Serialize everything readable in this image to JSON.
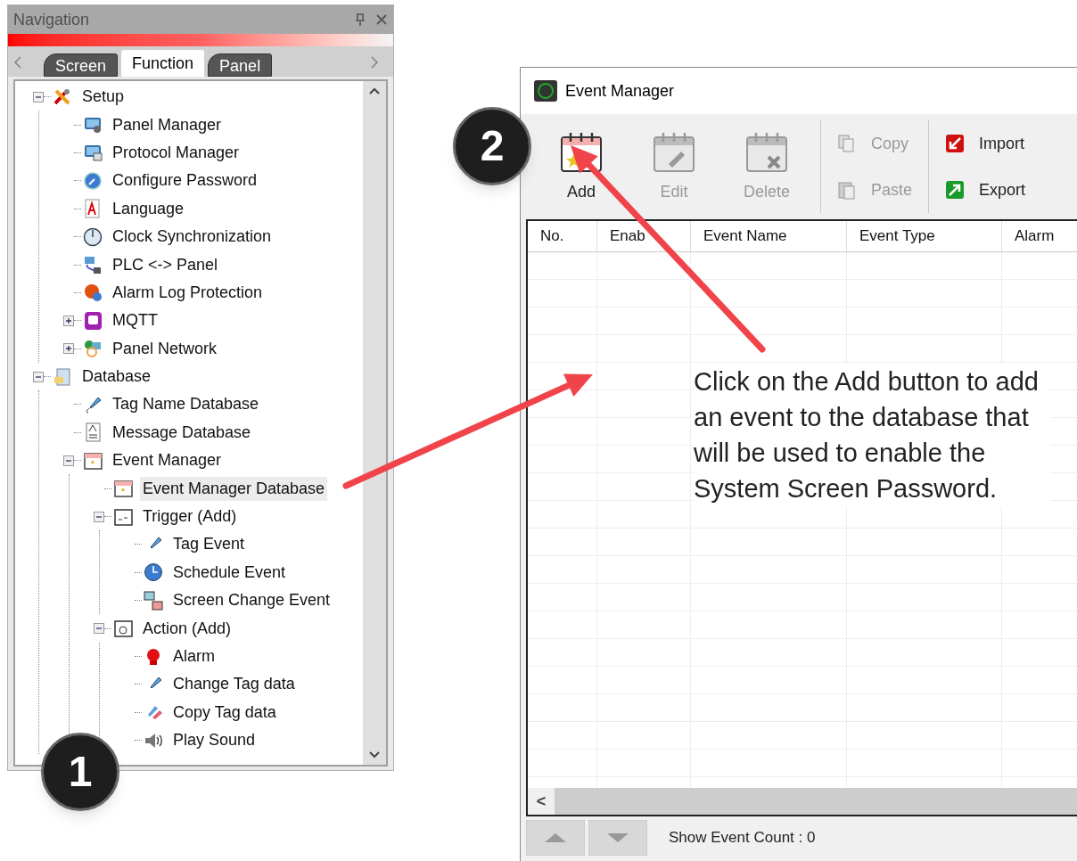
{
  "navigation": {
    "title": "Navigation",
    "tabs": [
      {
        "label": "Screen",
        "selected": false
      },
      {
        "label": "Function",
        "selected": true
      },
      {
        "label": "Panel",
        "selected": false
      }
    ],
    "tree": [
      {
        "label": "Setup",
        "expanded": true,
        "selected": false,
        "children": [
          {
            "label": "Panel Manager",
            "selected": false
          },
          {
            "label": "Protocol Manager",
            "selected": false
          },
          {
            "label": "Configure Password",
            "selected": false
          },
          {
            "label": "Language",
            "selected": false
          },
          {
            "label": "Clock Synchronization",
            "selected": false
          },
          {
            "label": "PLC <-> Panel",
            "selected": false
          },
          {
            "label": "Alarm Log Protection",
            "selected": false
          },
          {
            "label": "MQTT",
            "expanded": false,
            "selected": false
          },
          {
            "label": "Panel Network",
            "expanded": false,
            "selected": false
          }
        ]
      },
      {
        "label": "Database",
        "expanded": true,
        "selected": false,
        "children": [
          {
            "label": "Tag Name Database",
            "selected": false
          },
          {
            "label": "Message Database",
            "selected": false
          },
          {
            "label": "Event Manager",
            "expanded": true,
            "selected": false,
            "children": [
              {
                "label": "Event Manager Database",
                "selected": true
              },
              {
                "label": "Trigger (Add)",
                "expanded": true,
                "selected": false,
                "children": [
                  {
                    "label": "Tag Event",
                    "selected": false
                  },
                  {
                    "label": "Schedule Event",
                    "selected": false
                  },
                  {
                    "label": "Screen Change Event",
                    "selected": false
                  }
                ]
              },
              {
                "label": "Action (Add)",
                "expanded": true,
                "selected": false,
                "children": [
                  {
                    "label": "Alarm",
                    "selected": false
                  },
                  {
                    "label": "Change Tag data",
                    "selected": false
                  },
                  {
                    "label": "Copy Tag data",
                    "selected": false
                  },
                  {
                    "label": "Play Sound",
                    "selected": false
                  }
                ]
              }
            ]
          }
        ]
      }
    ]
  },
  "event_manager": {
    "title": "Event Manager",
    "toolbar": [
      {
        "label": "Add",
        "disabled": false,
        "kind": "large"
      },
      {
        "label": "Edit",
        "disabled": true,
        "kind": "large"
      },
      {
        "label": "Delete",
        "disabled": true,
        "kind": "large"
      },
      {
        "label": "Copy",
        "disabled": true,
        "kind": "small"
      },
      {
        "label": "Paste",
        "disabled": true,
        "kind": "small"
      },
      {
        "label": "Import",
        "disabled": false,
        "kind": "small"
      },
      {
        "label": "Export",
        "disabled": false,
        "kind": "small"
      }
    ],
    "columns": [
      "No.",
      "Enab",
      "Event Name",
      "Event Type",
      "Alarm"
    ],
    "scroll_left": "<",
    "status": "Show Event Count : 0"
  },
  "callouts": [
    "1",
    "2"
  ],
  "annotation": "Click on the Add button to add an event to the database that will be used to enable the System Screen Password."
}
